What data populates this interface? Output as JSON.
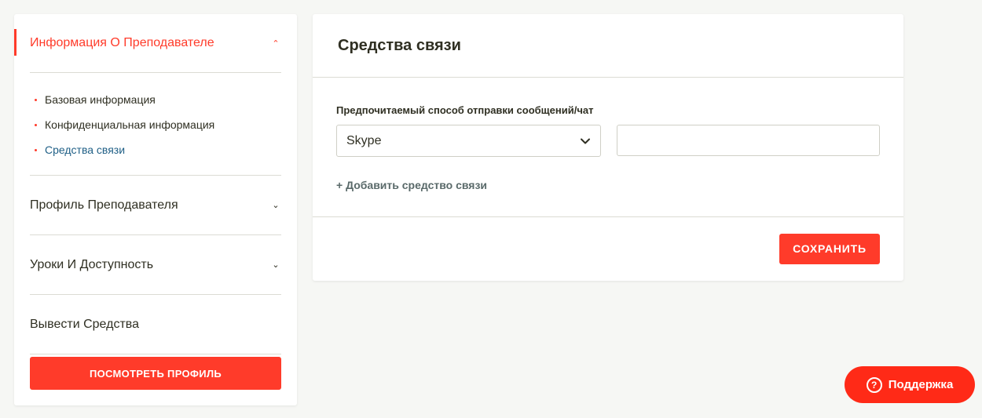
{
  "sidebar": {
    "sections": [
      {
        "label": "Информация О Преподавателе",
        "expanded": true,
        "items": [
          {
            "label": "Базовая информация"
          },
          {
            "label": "Конфиденциальная информация"
          },
          {
            "label": "Средства связи",
            "current": true
          }
        ]
      },
      {
        "label": "Профиль Преподавателя",
        "expanded": false
      },
      {
        "label": "Уроки И Доступность",
        "expanded": false
      },
      {
        "label": "Вывести Средства"
      }
    ],
    "view_profile_label": "ПОСМОТРЕТЬ ПРОФИЛЬ"
  },
  "main": {
    "title": "Средства связи",
    "messenger_field": {
      "label": "Предпочитаемый способ отправки сообщений/чат",
      "selected": "Skype",
      "value": ""
    },
    "add_link": "+ Добавить средство связи",
    "save_label": "СОХРАНИТЬ"
  },
  "support": {
    "label": "Поддержка",
    "icon": "question-circle-icon"
  },
  "colors": {
    "accent": "#ff3b2a",
    "active_link": "#1f5f86",
    "background": "#f6f7f4"
  }
}
